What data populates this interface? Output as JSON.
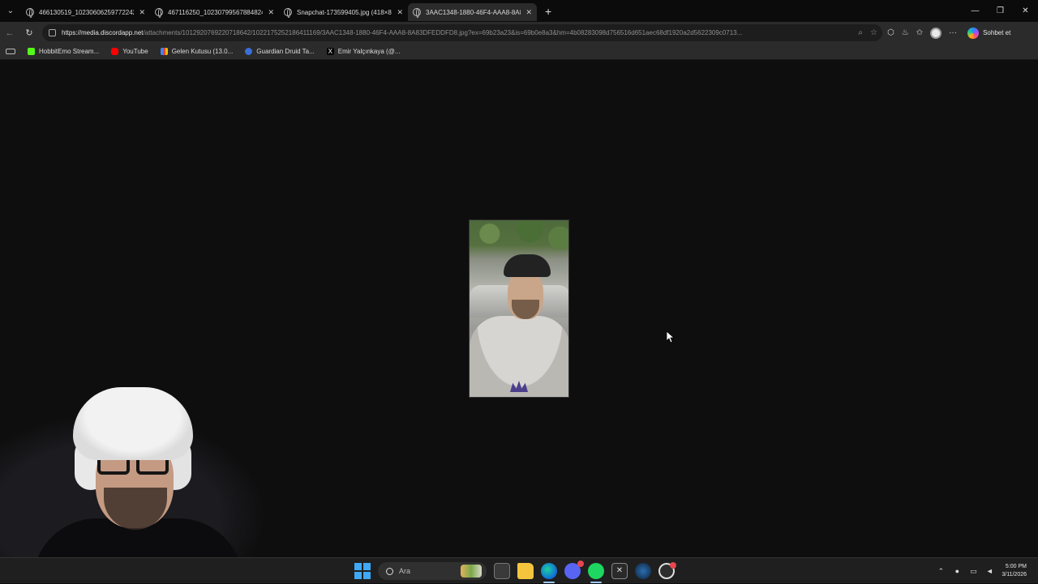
{
  "tabs": [
    {
      "title": "466130519_10230606259772242_",
      "active": false
    },
    {
      "title": "467116250_10230799567884824_",
      "active": false
    },
    {
      "title": "Snapchat-173599405.jpg (418×8",
      "active": false
    },
    {
      "title": "3AAC1348-1880-46F4-AAA8-8A8",
      "active": true
    }
  ],
  "window": {
    "minimize": "—",
    "maximize": "❐",
    "close": "✕",
    "tab_menu": "⌄",
    "new_tab": "+"
  },
  "address_bar": {
    "host": "https://media.discordapp.net",
    "path": "/attachments/1012920769220718642/1022175252186411169/3AAC1348-1880-46F4-AAA8-8A83DFEDDFD8.jpg?ex=69b23a23&is=69b0e8a3&hm=4b08283098d756516d651aec68df1920a2d5622309c0713..."
  },
  "toolbar_right": {
    "copilot_label": "Sohbet et"
  },
  "bookmarks": [
    {
      "label": "HobbitEmo Stream...",
      "icon": "kick"
    },
    {
      "label": "YouTube",
      "icon": "yt"
    },
    {
      "label": "Gelen Kutusu (13.0...",
      "icon": "gmail"
    },
    {
      "label": "Guardian Druid Ta...",
      "icon": "wow"
    },
    {
      "label": "Emir Yalçınkaya (@...",
      "icon": "x"
    }
  ],
  "taskbar": {
    "search_placeholder": "Ara",
    "time": "5:00 PM",
    "date": "3/11/2026"
  }
}
